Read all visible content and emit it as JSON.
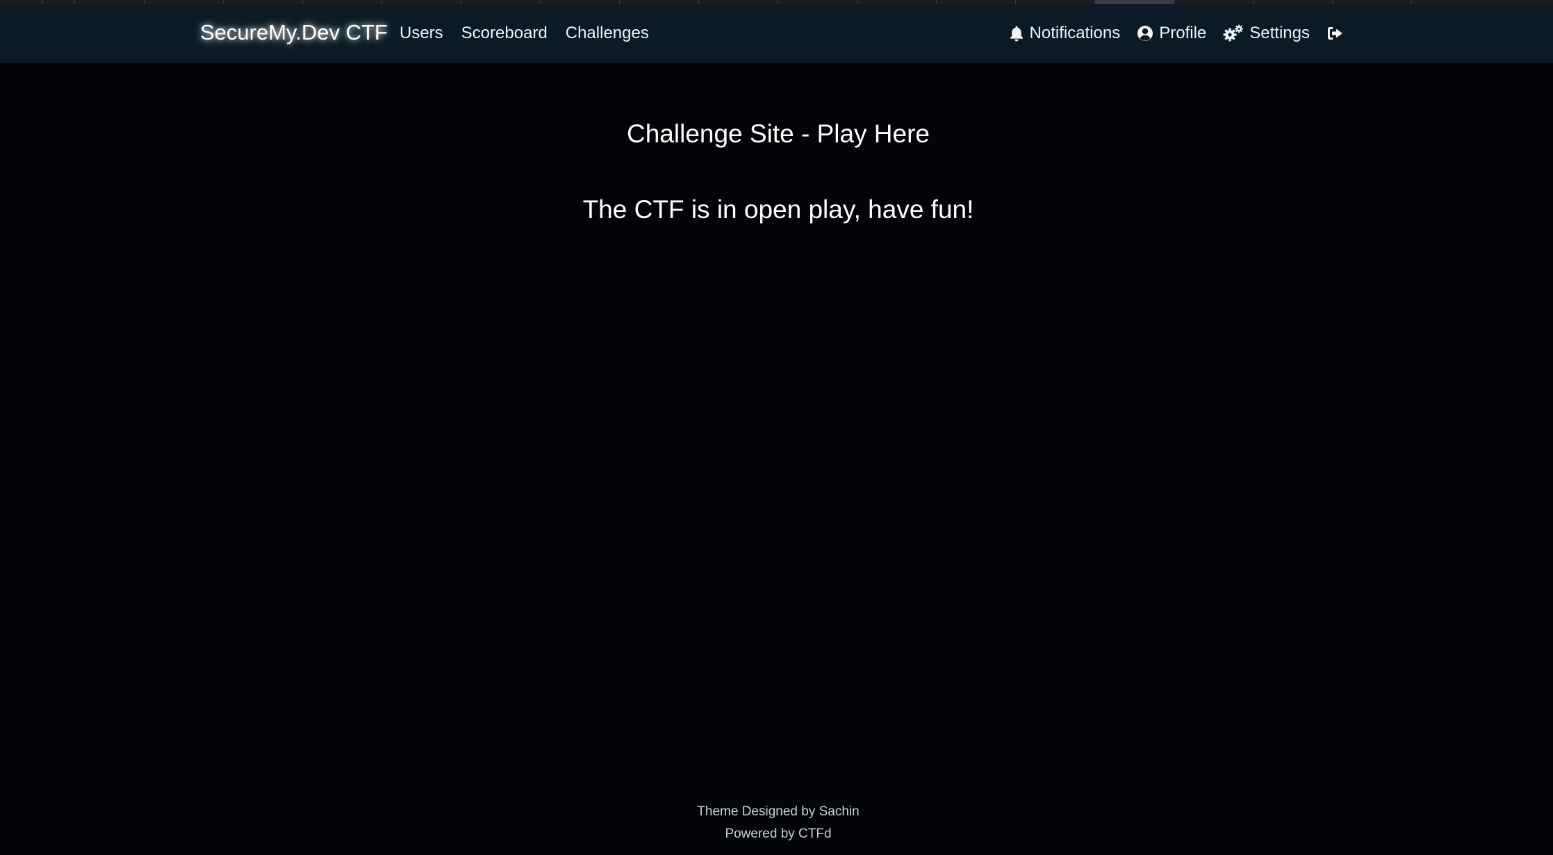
{
  "navbar": {
    "brand": "SecureMy.Dev CTF",
    "left_links": [
      {
        "label": "Users"
      },
      {
        "label": "Scoreboard"
      },
      {
        "label": "Challenges"
      }
    ],
    "right_links": [
      {
        "label": "Notifications",
        "icon": "bell-icon"
      },
      {
        "label": "Profile",
        "icon": "user-circle-icon"
      },
      {
        "label": "Settings",
        "icon": "gears-icon"
      },
      {
        "label": "",
        "icon": "logout-icon"
      }
    ]
  },
  "main": {
    "title": "Challenge Site - Play Here",
    "message": "The CTF is in open play, have fun!"
  },
  "footer": {
    "line1": "Theme Designed by Sachin",
    "line2": "Powered by CTFd"
  },
  "colors": {
    "background": "#020408",
    "navbar": "#0b1a25",
    "text": "#f1f3f5"
  }
}
